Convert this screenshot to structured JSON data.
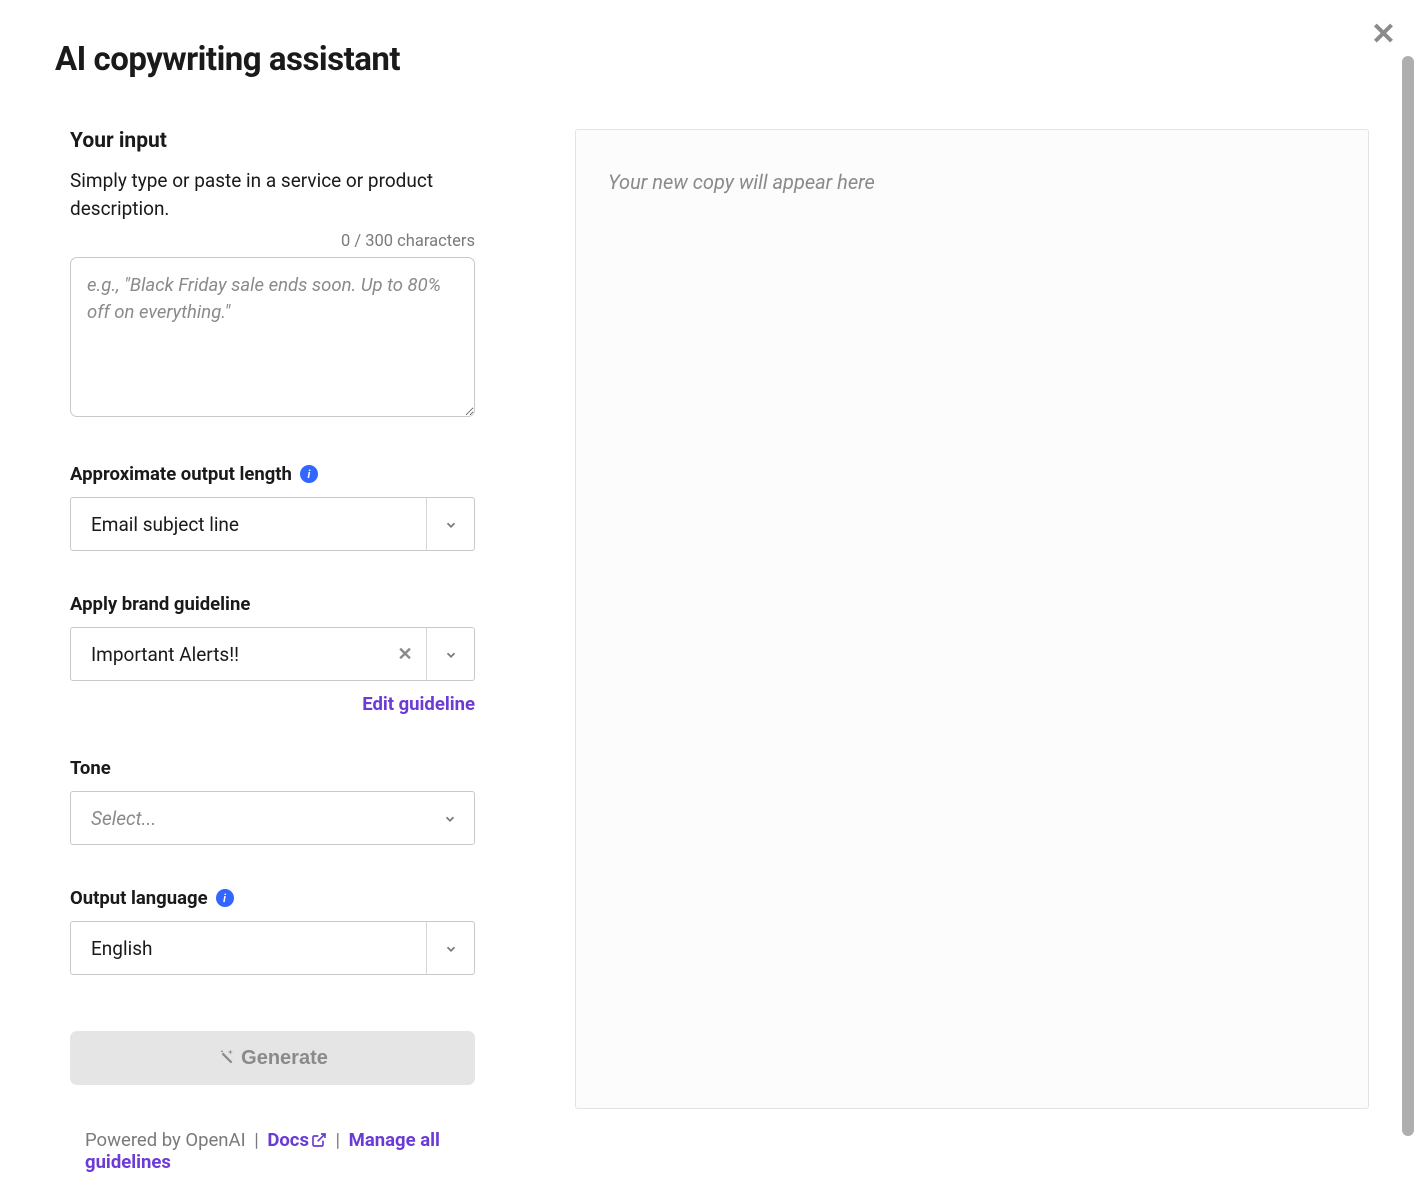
{
  "title": "AI copywriting assistant",
  "input": {
    "heading": "Your input",
    "description": "Simply type or paste in a service or product description.",
    "char_counter": "0 / 300 characters",
    "placeholder": "e.g., \"Black Friday sale ends soon. Up to 80% off on everything.\""
  },
  "length": {
    "label": "Approximate output length",
    "value": "Email subject line"
  },
  "brand": {
    "label": "Apply brand guideline",
    "value": "Important Alerts!!",
    "edit_link": "Edit guideline"
  },
  "tone": {
    "label": "Tone",
    "placeholder": "Select..."
  },
  "language": {
    "label": "Output language",
    "value": "English"
  },
  "generate_label": "Generate",
  "output": {
    "placeholder": "Your new copy will appear here"
  },
  "footer": {
    "powered": "Powered by OpenAI",
    "docs": "Docs",
    "manage": "Manage all guidelines"
  }
}
